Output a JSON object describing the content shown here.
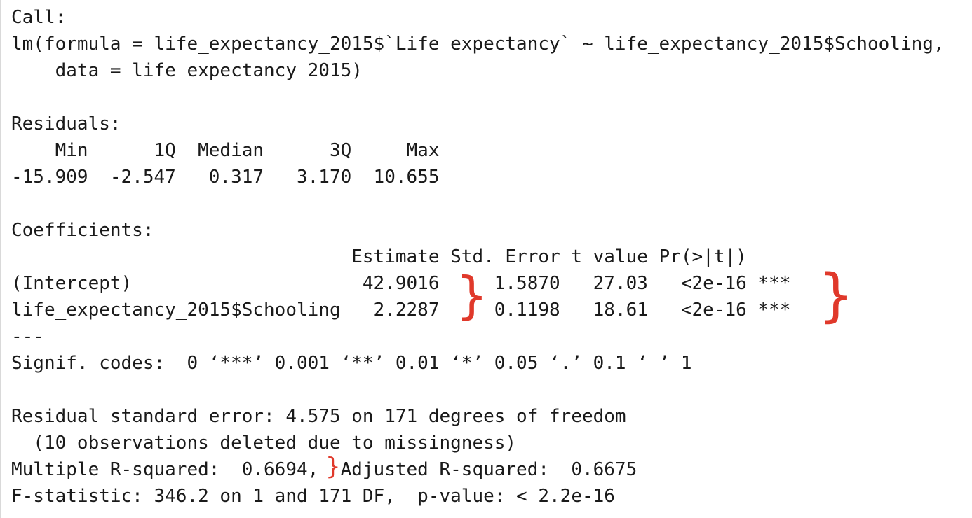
{
  "console": {
    "lines": [
      "Call:",
      "lm(formula = life_expectancy_2015$`Life expectancy` ~ life_expectancy_2015$Schooling,",
      "    data = life_expectancy_2015)",
      "",
      "Residuals:",
      "    Min      1Q  Median      3Q     Max ",
      "-15.909  -2.547   0.317   3.170  10.655 ",
      "",
      "Coefficients:",
      "                               Estimate Std. Error t value Pr(>|t|)    ",
      "(Intercept)                     42.9016     1.5870   27.03   <2e-16 ***",
      "life_expectancy_2015$Schooling   2.2287     0.1198   18.61   <2e-16 ***",
      "---",
      "Signif. codes:  0 ‘***’ 0.001 ‘**’ 0.01 ‘*’ 0.05 ‘.’ 0.1 ‘ ’ 1",
      "",
      "Residual standard error: 4.575 on 171 degrees of freedom",
      "  (10 observations deleted due to missingness)",
      "Multiple R-squared:  0.6694,  Adjusted R-squared:  0.6675 ",
      "F-statistic: 346.2 on 1 and 171 DF,  p-value: < 2.2e-16"
    ]
  },
  "annotations": {
    "color": "#e0392b",
    "glyph": "}"
  }
}
